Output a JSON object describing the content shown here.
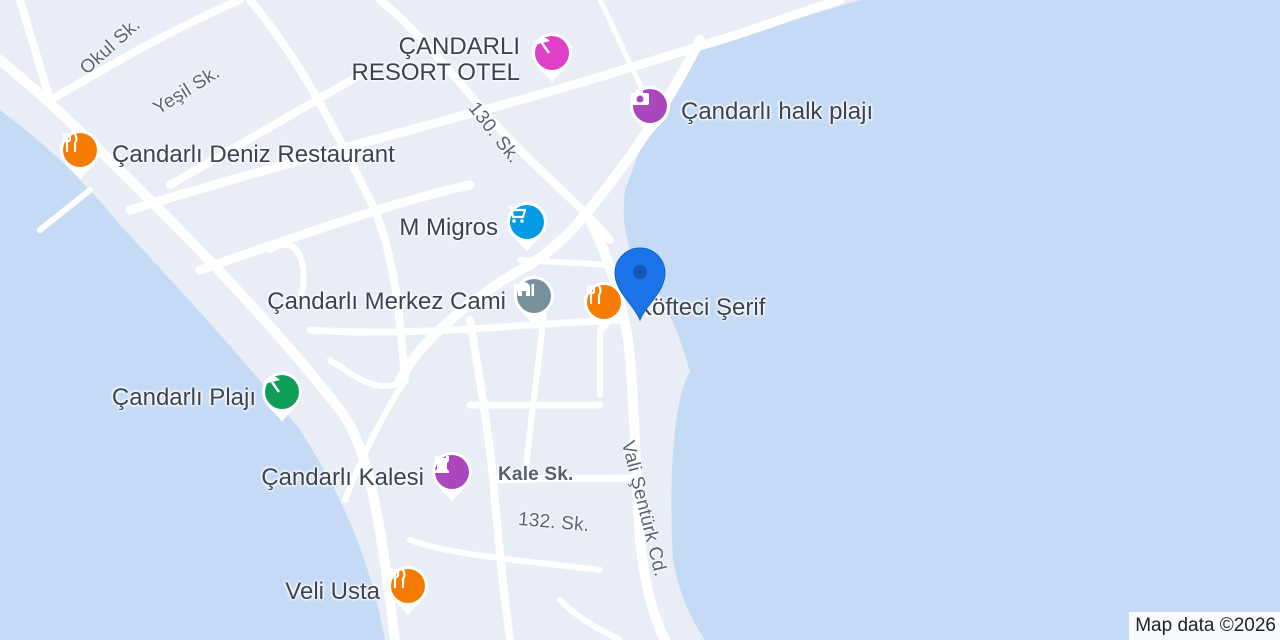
{
  "map": {
    "attribution": "Map data ©2026",
    "colors": {
      "water": "#c5dbf5",
      "land": "#e9edf5",
      "road": "#ffffff",
      "restaurant": "#f57c00",
      "shopping": "#039be5",
      "worship": "#78909c",
      "beach": "#0f9d58",
      "landmark": "#ab47bc",
      "hotel": "#e040c8",
      "selected_marker": "#1a73e8"
    },
    "streets": [
      {
        "name": "Okul Sk."
      },
      {
        "name": "Yeşil Sk."
      },
      {
        "name": "130. Sk."
      },
      {
        "name": "Kale Sk."
      },
      {
        "name": "132. Sk."
      },
      {
        "name": "Vali Şentürk Cd."
      }
    ],
    "pois": [
      {
        "name": "ÇANDARLI\nRESORT OTEL",
        "category": "hotel",
        "icon": "beach-umbrella-icon"
      },
      {
        "name": "Çandarlı halk plajı",
        "category": "landmark",
        "icon": "camera-icon"
      },
      {
        "name": "Çandarlı Deniz Restaurant",
        "category": "restaurant",
        "icon": "fork-knife-icon"
      },
      {
        "name": "M Migros",
        "category": "shopping",
        "icon": "shopping-cart-icon"
      },
      {
        "name": "Çandarlı Merkez Cami",
        "category": "worship",
        "icon": "mosque-icon"
      },
      {
        "name": "Köfteci Şerif",
        "category": "restaurant",
        "icon": "fork-knife-icon"
      },
      {
        "name": "Çandarlı Plajı",
        "category": "beach",
        "icon": "beach-umbrella-icon"
      },
      {
        "name": "Çandarlı Kalesi",
        "category": "landmark",
        "icon": "castle-icon"
      },
      {
        "name": "Veli Usta",
        "category": "restaurant",
        "icon": "fork-knife-icon"
      }
    ],
    "selected_marker": {
      "icon": "map-pin-icon"
    }
  }
}
